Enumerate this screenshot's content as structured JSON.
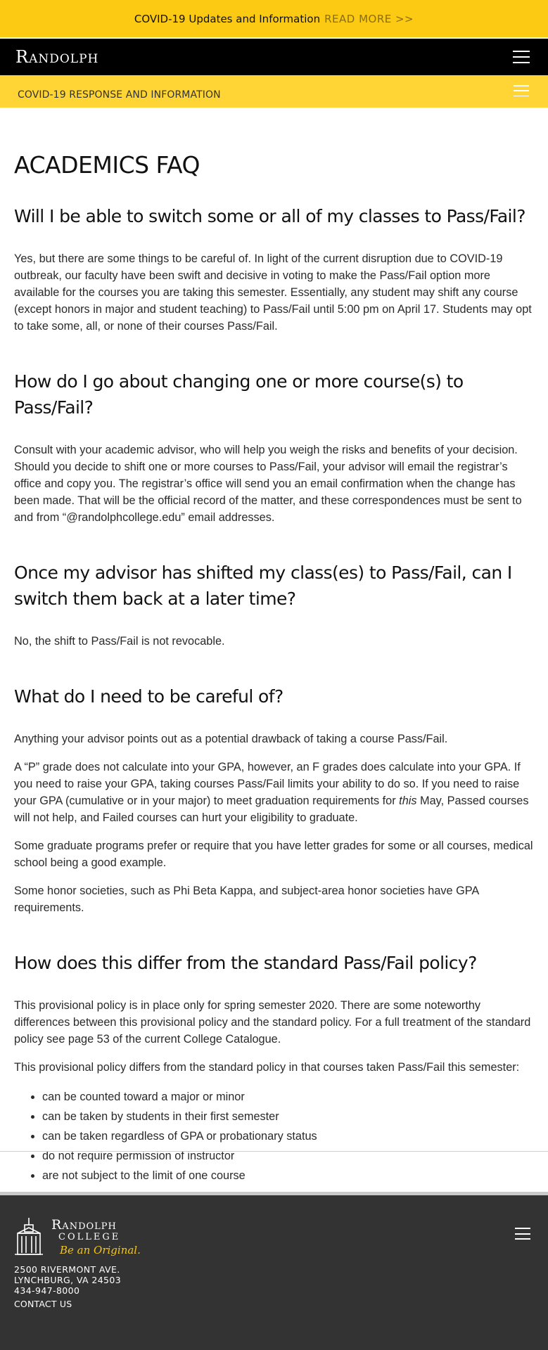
{
  "alert": {
    "text": "COVID-19 Updates and Information",
    "link": "READ MORE >>"
  },
  "header": {
    "logo": "Randolph",
    "menu_icon": "hamburger-menu-icon"
  },
  "subnav": {
    "title": "COVID-19 RESPONSE AND INFORMATION",
    "menu_icon": "hamburger-menu-icon"
  },
  "page": {
    "title": "ACADEMICS FAQ",
    "sections": [
      {
        "heading": "Will I be able to switch some or all of my classes to Pass/Fail?",
        "paragraphs": [
          "Yes, but there are some things to be careful of.  In light of the current disruption due to COVID-19 outbreak, our faculty have been swift and decisive in voting to make the Pass/Fail option more available for the courses you are taking this semester. Essentially, any student may shift any course (except honors in major and student teaching) to Pass/Fail until 5:00 pm on April 17. Students may opt to take some, all, or none of their courses Pass/Fail."
        ]
      },
      {
        "heading": "How do I go about changing one or more course(s) to Pass/Fail?",
        "paragraphs": [
          "Consult with your academic advisor, who will help you weigh the risks and benefits of your decision. Should you decide to shift one or more courses to Pass/Fail, your advisor will email the registrar’s office and copy you.  The registrar’s office will send you an email confirmation when the change has been made. That will be the official record of the matter, and these correspondences must be sent to and from “@randolphcollege.edu” email addresses."
        ]
      },
      {
        "heading": "Once my advisor has shifted my class(es) to Pass/Fail, can I switch them back at a later time?",
        "paragraphs": [
          "No, the shift to Pass/Fail is not revocable."
        ]
      },
      {
        "heading": "What do I need to be careful of?",
        "paragraphs": [
          "Anything your advisor points out as a potential drawback of taking a course Pass/Fail.",
          "A “P” grade does not calculate into your GPA, however, an F grades does calculate into your GPA. If you need to raise your GPA, taking courses Pass/Fail limits your ability to do so.  If you need to raise your GPA (cumulative or in your major) to meet graduation requirements for this May, Passed courses will not help, and Failed courses can hurt your eligibility to graduate.",
          "Some graduate programs prefer or require that you have letter grades for some or all courses, medical school being a good example.",
          "Some honor societies, such as Phi Beta Kappa, and subject-area honor societies have GPA requirements."
        ]
      },
      {
        "heading": "How does this differ from the standard Pass/Fail policy?",
        "paragraphs": [
          "This provisional policy is in place only for spring semester 2020. There are some noteworthy differences between this provisional policy and the standard policy. For a full treatment of the standard policy see page 53 of the current College Catalogue.",
          "This provisional policy differs from the standard policy in that courses taken Pass/Fail this semester:"
        ],
        "list": [
          "can be counted toward a major or minor",
          "can be taken by students in their first semester",
          "can be taken regardless of GPA or probationary status",
          "do not require permission of instructor",
          "are not subject to the limit of one course"
        ]
      }
    ]
  },
  "footer": {
    "logo_name": "Randolph",
    "logo_college": "COLLEGE",
    "logo_tagline": "Be an Original.",
    "address_line1": "2500 RIVERMONT AVE.",
    "address_line2": "LYNCHBURG, VA 24503",
    "phone": "434-947-8000",
    "contact": "CONTACT US"
  },
  "colors": {
    "alert_bg": "#fcca12",
    "subnav_bg": "#fed534",
    "header_bg": "#000000",
    "footer_bg": "#333333",
    "tagline": "#f5c518"
  }
}
